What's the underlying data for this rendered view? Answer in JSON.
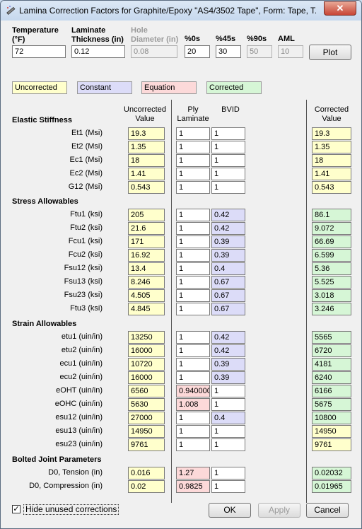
{
  "window": {
    "title": "Lamina Correction Factors for Graphite/Epoxy \"AS4/3502 Tape\", Form: Tape, T...",
    "close_label": "✕"
  },
  "header": {
    "temperature_label": "Temperature (°F)",
    "temperature_value": "72",
    "thickness_label": "Laminate Thickness (in)",
    "thickness_value": "0.12",
    "hole_label": "Hole Diameter (in)",
    "hole_value": "0.08",
    "p0_label": "%0s",
    "p0_value": "20",
    "p45_label": "%45s",
    "p45_value": "30",
    "p90_label": "%90s",
    "p90_value": "50",
    "aml_label": "AML",
    "aml_value": "10",
    "plot_label": "Plot"
  },
  "legend": {
    "uncorrected": "Uncorrected",
    "constant": "Constant",
    "equation": "Equation",
    "corrected": "Corrected"
  },
  "columns": {
    "uncorrected": "Uncorrected Value",
    "ply": "Ply Laminate",
    "bvid": "BVID",
    "corrected": "Corrected Value"
  },
  "sections": {
    "elastic": "Elastic Stiffness",
    "stress": "Stress Allowables",
    "strain": "Strain Allowables",
    "bolted": "Bolted Joint Parameters"
  },
  "rows": [
    {
      "label": "Et1 (Msi)",
      "uncorrected": "19.3",
      "ply": "1",
      "ply_kind": "wh",
      "bvid": "1",
      "bvid_kind": "wh",
      "corrected": "19.3",
      "corrected_kind": "uv"
    },
    {
      "label": "Et2 (Msi)",
      "uncorrected": "1.35",
      "ply": "1",
      "ply_kind": "wh",
      "bvid": "1",
      "bvid_kind": "wh",
      "corrected": "1.35",
      "corrected_kind": "uv"
    },
    {
      "label": "Ec1 (Msi)",
      "uncorrected": "18",
      "ply": "1",
      "ply_kind": "wh",
      "bvid": "1",
      "bvid_kind": "wh",
      "corrected": "18",
      "corrected_kind": "uv"
    },
    {
      "label": "Ec2 (Msi)",
      "uncorrected": "1.41",
      "ply": "1",
      "ply_kind": "wh",
      "bvid": "1",
      "bvid_kind": "wh",
      "corrected": "1.41",
      "corrected_kind": "uv"
    },
    {
      "label": "G12 (Msi)",
      "uncorrected": "0.543",
      "ply": "1",
      "ply_kind": "wh",
      "bvid": "1",
      "bvid_kind": "wh",
      "corrected": "0.543",
      "corrected_kind": "uv"
    },
    {
      "label": "Ftu1 (ksi)",
      "uncorrected": "205",
      "ply": "1",
      "ply_kind": "wh",
      "bvid": "0.42",
      "bvid_kind": "ct",
      "corrected": "86.1",
      "corrected_kind": "cv"
    },
    {
      "label": "Ftu2 (ksi)",
      "uncorrected": "21.6",
      "ply": "1",
      "ply_kind": "wh",
      "bvid": "0.42",
      "bvid_kind": "ct",
      "corrected": "9.072",
      "corrected_kind": "cv"
    },
    {
      "label": "Fcu1 (ksi)",
      "uncorrected": "171",
      "ply": "1",
      "ply_kind": "wh",
      "bvid": "0.39",
      "bvid_kind": "ct",
      "corrected": "66.69",
      "corrected_kind": "cv"
    },
    {
      "label": "Fcu2 (ksi)",
      "uncorrected": "16.92",
      "ply": "1",
      "ply_kind": "wh",
      "bvid": "0.39",
      "bvid_kind": "ct",
      "corrected": "6.599",
      "corrected_kind": "cv"
    },
    {
      "label": "Fsu12 (ksi)",
      "uncorrected": "13.4",
      "ply": "1",
      "ply_kind": "wh",
      "bvid": "0.4",
      "bvid_kind": "ct",
      "corrected": "5.36",
      "corrected_kind": "cv"
    },
    {
      "label": "Fsu13 (ksi)",
      "uncorrected": "8.246",
      "ply": "1",
      "ply_kind": "wh",
      "bvid": "0.67",
      "bvid_kind": "ct",
      "corrected": "5.525",
      "corrected_kind": "cv"
    },
    {
      "label": "Fsu23 (ksi)",
      "uncorrected": "4.505",
      "ply": "1",
      "ply_kind": "wh",
      "bvid": "0.67",
      "bvid_kind": "ct",
      "corrected": "3.018",
      "corrected_kind": "cv"
    },
    {
      "label": "Ftu3 (ksi)",
      "uncorrected": "4.845",
      "ply": "1",
      "ply_kind": "wh",
      "bvid": "0.67",
      "bvid_kind": "ct",
      "corrected": "3.246",
      "corrected_kind": "cv"
    },
    {
      "label": "etu1 (uin/in)",
      "uncorrected": "13250",
      "ply": "1",
      "ply_kind": "wh",
      "bvid": "0.42",
      "bvid_kind": "ct",
      "corrected": "5565",
      "corrected_kind": "cv"
    },
    {
      "label": "etu2 (uin/in)",
      "uncorrected": "16000",
      "ply": "1",
      "ply_kind": "wh",
      "bvid": "0.42",
      "bvid_kind": "ct",
      "corrected": "6720",
      "corrected_kind": "cv"
    },
    {
      "label": "ecu1 (uin/in)",
      "uncorrected": "10720",
      "ply": "1",
      "ply_kind": "wh",
      "bvid": "0.39",
      "bvid_kind": "ct",
      "corrected": "4181",
      "corrected_kind": "cv"
    },
    {
      "label": "ecu2 (uin/in)",
      "uncorrected": "16000",
      "ply": "1",
      "ply_kind": "wh",
      "bvid": "0.39",
      "bvid_kind": "ct",
      "corrected": "6240",
      "corrected_kind": "cv"
    },
    {
      "label": "eOHT (uin/in)",
      "uncorrected": "6560",
      "ply": "0.940000",
      "ply_kind": "eq",
      "bvid": "1",
      "bvid_kind": "wh",
      "corrected": "6166",
      "corrected_kind": "cv"
    },
    {
      "label": "eOHC (uin/in)",
      "uncorrected": "5630",
      "ply": "1.008",
      "ply_kind": "eq",
      "bvid": "1",
      "bvid_kind": "wh",
      "corrected": "5675",
      "corrected_kind": "cv"
    },
    {
      "label": "esu12 (uin/in)",
      "uncorrected": "27000",
      "ply": "1",
      "ply_kind": "wh",
      "bvid": "0.4",
      "bvid_kind": "ct",
      "corrected": "10800",
      "corrected_kind": "cv"
    },
    {
      "label": "esu13 (uin/in)",
      "uncorrected": "14950",
      "ply": "1",
      "ply_kind": "wh",
      "bvid": "1",
      "bvid_kind": "wh",
      "corrected": "14950",
      "corrected_kind": "uv"
    },
    {
      "label": "esu23 (uin/in)",
      "uncorrected": "9761",
      "ply": "1",
      "ply_kind": "wh",
      "bvid": "1",
      "bvid_kind": "wh",
      "corrected": "9761",
      "corrected_kind": "uv"
    },
    {
      "label": "D0, Tension (in)",
      "uncorrected": "0.016",
      "ply": "1.27",
      "ply_kind": "eq",
      "bvid": "1",
      "bvid_kind": "wh",
      "corrected": "0.02032",
      "corrected_kind": "cv"
    },
    {
      "label": "D0, Compression (in)",
      "uncorrected": "0.02",
      "ply": "0.9825",
      "ply_kind": "eq",
      "bvid": "1",
      "bvid_kind": "wh",
      "corrected": "0.01965",
      "corrected_kind": "cv"
    }
  ],
  "footer": {
    "hide_label": "Hide unused corrections",
    "hide_checked": "✓",
    "ok_label": "OK",
    "apply_label": "Apply",
    "cancel_label": "Cancel"
  }
}
